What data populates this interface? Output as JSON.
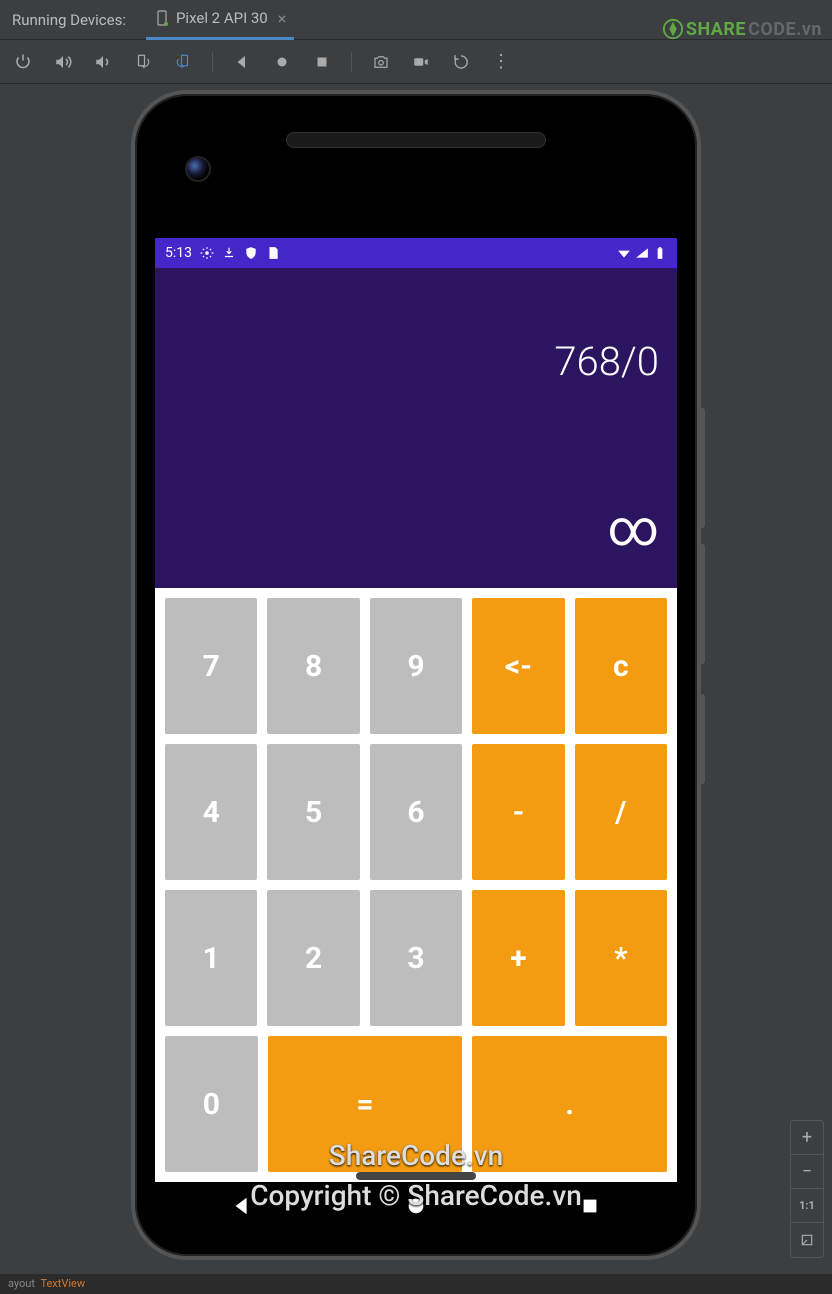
{
  "tabBar": {
    "label": "Running Devices:",
    "tabName": "Pixel 2 API 30"
  },
  "watermark": {
    "part1": "SHARE",
    "part2": "CODE.vn"
  },
  "statusBar": {
    "time": "5:13"
  },
  "calculator": {
    "expression": "768/0",
    "result": "∞",
    "keys": {
      "k7": "7",
      "k8": "8",
      "k9": "9",
      "back": "<-",
      "clear": "c",
      "k4": "4",
      "k5": "5",
      "k6": "6",
      "minus": "-",
      "divide": "/",
      "k1": "1",
      "k2": "2",
      "k3": "3",
      "plus": "+",
      "multiply": "*",
      "k0": "0",
      "equals": "=",
      "dot": "."
    }
  },
  "overlay": {
    "line1": "ShareCode.vn",
    "line2": "Copyright © ShareCode.vn"
  },
  "zoom": {
    "in": "+",
    "out": "−",
    "oneToOne": "1:1"
  },
  "bottom": {
    "a": "ayout",
    "b": "TextView"
  }
}
